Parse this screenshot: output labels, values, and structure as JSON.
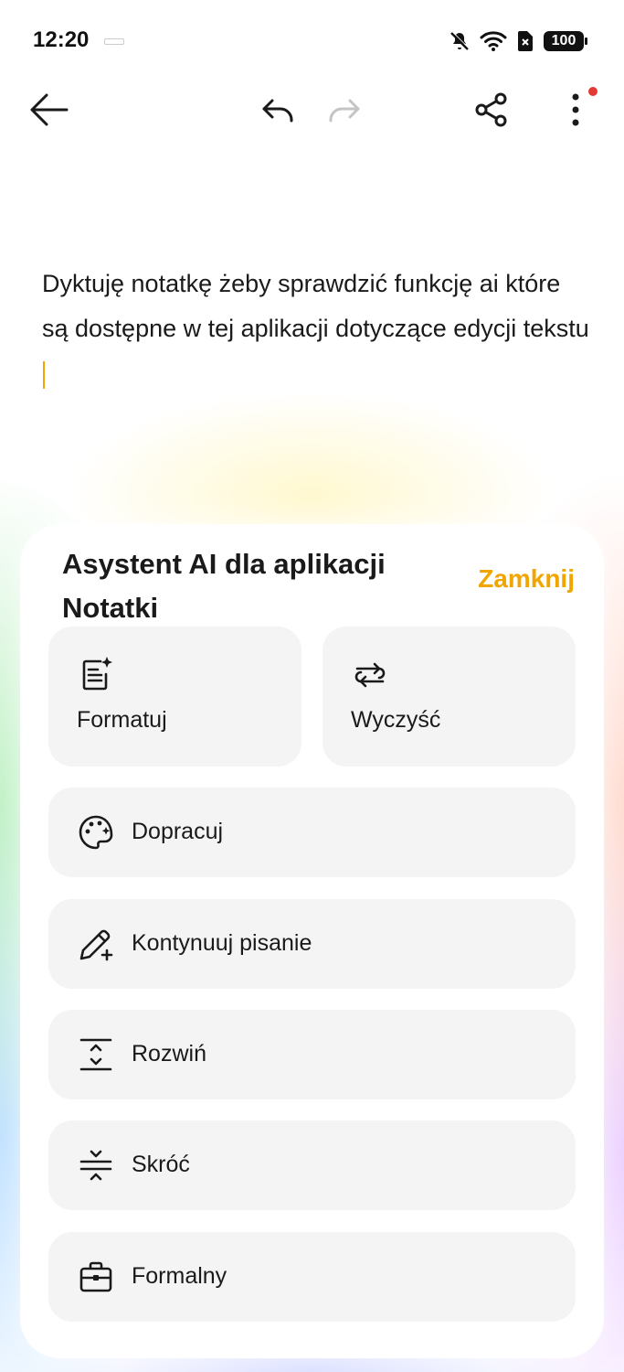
{
  "status_bar": {
    "time": "12:20",
    "battery": "100"
  },
  "toolbar": {
    "back_icon": "arrow-left-icon",
    "undo_icon": "undo-icon",
    "redo_icon": "redo-icon",
    "share_icon": "share-icon",
    "more_icon": "more-vertical-icon"
  },
  "note": {
    "text": "Dyktuję notatkę żeby sprawdzić funkcję ai które są dostępne w tej aplikacji dotyczące edycji tekstu"
  },
  "assistant": {
    "title": "Asystent AI dla aplikacji Notatki",
    "close_label": "Zamknij",
    "accent_color": "#f0a500",
    "actions": [
      {
        "label": "Formatuj",
        "icon": "format-document-icon"
      },
      {
        "label": "Wyczyść",
        "icon": "swap-arrows-icon"
      },
      {
        "label": "Dopracuj",
        "icon": "palette-icon"
      },
      {
        "label": "Kontynuuj pisanie",
        "icon": "pencil-plus-icon"
      },
      {
        "label": "Rozwiń",
        "icon": "expand-icon"
      },
      {
        "label": "Skróć",
        "icon": "collapse-icon"
      },
      {
        "label": "Formalny",
        "icon": "briefcase-icon"
      }
    ]
  }
}
